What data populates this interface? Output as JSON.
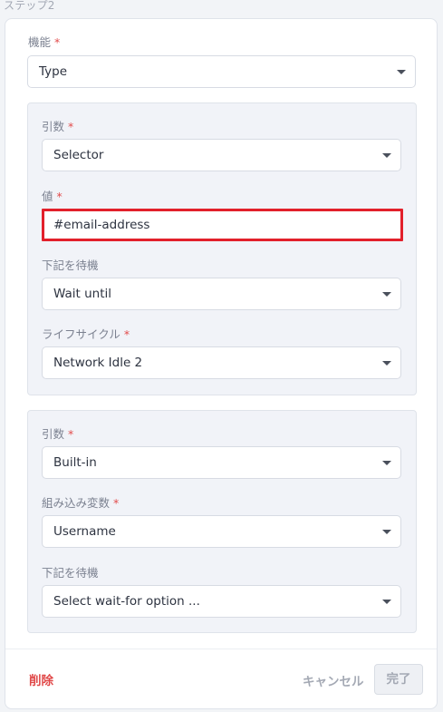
{
  "step_label": "ステップ2",
  "function_field": {
    "label": "機能",
    "required": "*",
    "value": "Type"
  },
  "group1": {
    "arg": {
      "label": "引数",
      "required": "*",
      "value": "Selector"
    },
    "value_field": {
      "label": "値",
      "required": "*",
      "value": "#email-address"
    },
    "wait_for": {
      "label": "下記を待機",
      "value": "Wait until"
    },
    "lifecycle": {
      "label": "ライフサイクル",
      "required": "*",
      "value": "Network Idle 2"
    }
  },
  "group2": {
    "arg": {
      "label": "引数",
      "required": "*",
      "value": "Built-in"
    },
    "builtin_var": {
      "label": "組み込み変数",
      "required": "*",
      "value": "Username"
    },
    "wait_for": {
      "label": "下記を待機",
      "placeholder": "Select wait-for option ..."
    }
  },
  "footer": {
    "delete_label": "削除",
    "cancel_label": "キャンセル",
    "done_label": "完了"
  },
  "colors": {
    "required": "#e24c4c",
    "highlight": "#e2202b",
    "delete": "#e04848"
  }
}
